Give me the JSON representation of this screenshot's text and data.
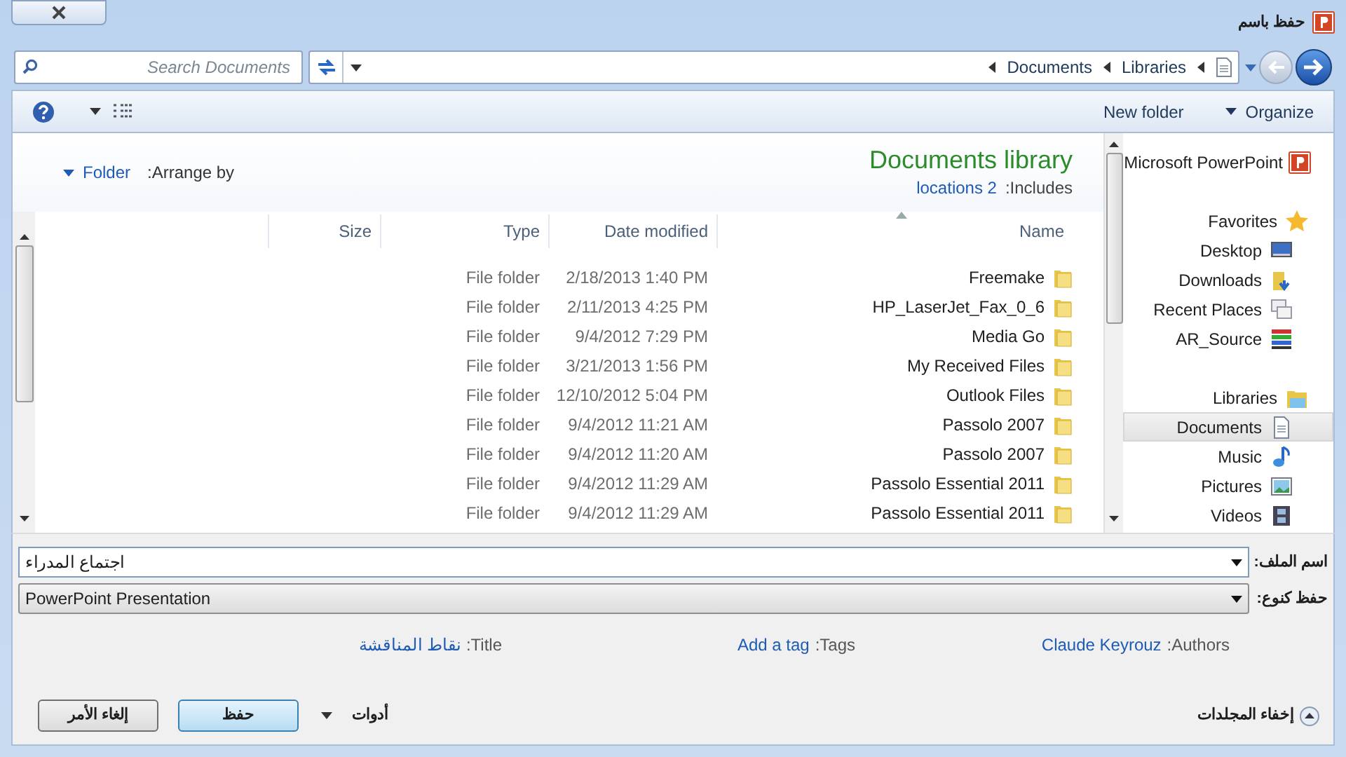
{
  "window": {
    "title": "حفظ باسم"
  },
  "search": {
    "placeholder": "Search Documents"
  },
  "breadcrumb": [
    "Documents",
    "Libraries"
  ],
  "toolbar": {
    "organize": "Organize",
    "new_folder": "New folder"
  },
  "library": {
    "title": "Documents library",
    "includes_label": ":Includes",
    "includes_value": "locations 2",
    "arrange_label": ":Arrange by",
    "arrange_value": "Folder"
  },
  "columns": [
    {
      "label": "Size",
      "sorted": false
    },
    {
      "label": "Type",
      "sorted": false
    },
    {
      "label": "Date modified",
      "sorted": false
    },
    {
      "label": "Name",
      "sorted": true
    }
  ],
  "rows": [
    {
      "name": "Freemake",
      "date": "2/18/2013 1:40 PM",
      "type": "File folder"
    },
    {
      "name": "HP_LaserJet_Fax_0_6",
      "date": "2/11/2013 4:25 PM",
      "type": "File folder"
    },
    {
      "name": "Media Go",
      "date": "9/4/2012 7:29 PM",
      "type": "File folder"
    },
    {
      "name": "My Received Files",
      "date": "3/21/2013 1:56 PM",
      "type": "File folder"
    },
    {
      "name": "Outlook Files",
      "date": "12/10/2012 5:04 PM",
      "type": "File folder"
    },
    {
      "name": "Passolo 2007",
      "date": "9/4/2012 11:21 AM",
      "type": "File folder"
    },
    {
      "name": "Passolo 2007",
      "date": "9/4/2012 11:20 AM",
      "type": "File folder"
    },
    {
      "name": "Passolo Essential 2011",
      "date": "9/4/2012 11:29 AM",
      "type": "File folder"
    },
    {
      "name": "Passolo Essential 2011",
      "date": "9/4/2012 11:29 AM",
      "type": "File folder"
    }
  ],
  "nav": {
    "app": "Microsoft PowerPoint",
    "groups": [
      {
        "label": "Favorites",
        "kind": "favorites",
        "children": [
          {
            "label": "Desktop",
            "kind": "desktop",
            "selected": false
          },
          {
            "label": "Downloads",
            "kind": "downloads",
            "selected": false
          },
          {
            "label": "Recent Places",
            "kind": "recent",
            "selected": false
          },
          {
            "label": "AR_Source",
            "kind": "books",
            "selected": false
          }
        ]
      },
      {
        "label": "Libraries",
        "kind": "libraries",
        "children": [
          {
            "label": "Documents",
            "kind": "documents",
            "selected": true
          },
          {
            "label": "Music",
            "kind": "music",
            "selected": false
          },
          {
            "label": "Pictures",
            "kind": "pictures",
            "selected": false
          },
          {
            "label": "Videos",
            "kind": "videos",
            "selected": false
          }
        ]
      }
    ]
  },
  "file_name": {
    "label": "اسم الملف:",
    "value": "اجتماع المدراء"
  },
  "save_type": {
    "label": "حفظ كنوع:",
    "value": "PowerPoint Presentation"
  },
  "metadata": [
    {
      "label": ":Title",
      "value": "نقاط المناقشة"
    },
    {
      "label": ":Tags",
      "value": "Add a tag"
    },
    {
      "label": ":Authors",
      "value": "Claude Keyrouz"
    }
  ],
  "buttons": {
    "hide_folders": "إخفاء المجلدات",
    "tools": "أدوات",
    "save": "حفظ",
    "cancel": "إلغاء الأمر"
  }
}
